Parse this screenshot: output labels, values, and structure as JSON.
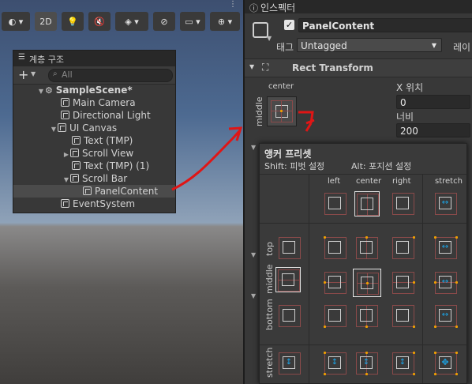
{
  "scene_toolbar": {
    "twod_label": "2D"
  },
  "hierarchy": {
    "title": "계층 구조",
    "add_label": "+",
    "search_placeholder": "All",
    "items": [
      {
        "label": "SampleScene*",
        "indent": 0
      },
      {
        "label": "Main Camera",
        "indent": 1
      },
      {
        "label": "Directional Light",
        "indent": 1
      },
      {
        "label": "UI Canvas",
        "indent": 1
      },
      {
        "label": "Text (TMP)",
        "indent": 2
      },
      {
        "label": "Scroll View",
        "indent": 2
      },
      {
        "label": "Text (TMP) (1)",
        "indent": 2
      },
      {
        "label": "Scroll Bar",
        "indent": 2
      },
      {
        "label": "PanelContent",
        "indent": 3
      },
      {
        "label": "EventSystem",
        "indent": 1
      }
    ]
  },
  "inspector": {
    "tab_label": "인스펙터",
    "object_name": "PanelContent",
    "tag_label": "태그",
    "tag_value": "Untagged",
    "layer_label": "레이",
    "component_title": "Rect Transform",
    "anchor_h_label": "center",
    "anchor_v_label": "middle",
    "pos_x_label": "X 위치",
    "pos_x_value": "0",
    "width_label": "너비",
    "width_value": "200"
  },
  "anchor_presets": {
    "title": "앵커 프리셋",
    "hint_shift": "Shift: 피벗 설정",
    "hint_alt": "Alt: 포지션 설정",
    "columns": [
      "left",
      "center",
      "right",
      "stretch"
    ],
    "rows": [
      "top",
      "middle",
      "bottom",
      "stretch"
    ]
  },
  "colors": {
    "accent_anchor": "#f0a000",
    "stretch_arrow": "#1ba4e6",
    "annotation": "#e01515"
  }
}
